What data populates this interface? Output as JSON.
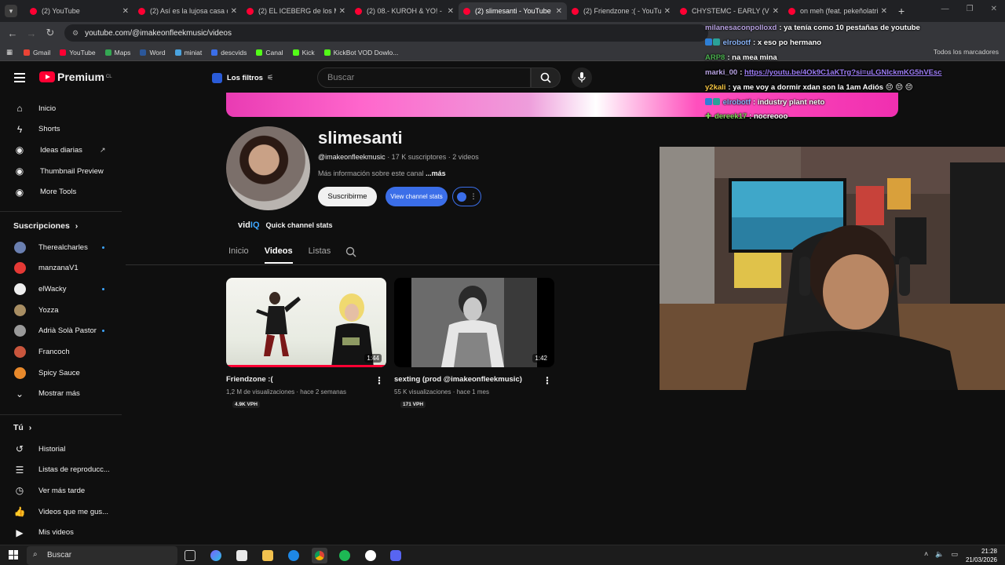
{
  "browser": {
    "tabs": [
      {
        "label": "(2) YouTube",
        "active": false
      },
      {
        "label": "(2) Así es la lujosa casa de",
        "active": false
      },
      {
        "label": "(2) EL ICEBERG de los MÚ",
        "active": false
      },
      {
        "label": "(2) 08.- KUROH & YO! - P",
        "active": false
      },
      {
        "label": "(2) slimesanti - YouTube",
        "active": true
      },
      {
        "label": "(2) Friendzone :( - YouTu",
        "active": false
      },
      {
        "label": "CHYSTEMC - EARLY (Vide",
        "active": false
      },
      {
        "label": "on meh (feat. pekeñolatri",
        "active": false
      }
    ],
    "url": "youtube.com/@imakeonfleekmusic/videos",
    "bookmarks": [
      "Gmail",
      "YouTube",
      "Maps",
      "Word",
      "miniat",
      "descvids",
      "Canal",
      "Kick",
      "KickBot VOD Dowlo..."
    ],
    "bookmark_colors": [
      "#ea4335",
      "#ff0033",
      "#34a853",
      "#2b579a",
      "#4aa3df",
      "#3b6ee8",
      "#53fc18",
      "#53fc18",
      "#53fc18"
    ],
    "all_bookmarks": "Todos los marcadores"
  },
  "header": {
    "logo": "Premium",
    "logo_country": "CL",
    "filters_label": "Los filtros",
    "search_placeholder": "Buscar"
  },
  "sidebar": {
    "main": [
      {
        "label": "Inicio",
        "icon": "home-icon"
      },
      {
        "label": "Shorts",
        "icon": "shorts-icon"
      },
      {
        "label": "Ideas diarias",
        "icon": "ideas-icon",
        "external": true
      },
      {
        "label": "Thumbnail Preview",
        "icon": "thumbnail-icon"
      },
      {
        "label": "More Tools",
        "icon": "tools-icon"
      }
    ],
    "subs_title": "Suscripciones",
    "subscriptions": [
      {
        "label": "Therealcharles",
        "color": "#6a7fb0",
        "dot": true
      },
      {
        "label": "manzanaV1",
        "color": "#e53935",
        "dot": false
      },
      {
        "label": "elWacky",
        "color": "#eeeeee",
        "dot": true
      },
      {
        "label": "Yozza",
        "color": "#a88e63",
        "dot": false
      },
      {
        "label": "Adrià Solà Pastor",
        "color": "#9a9a9a",
        "dot": true
      },
      {
        "label": "Francoch",
        "color": "#c9563d",
        "dot": false
      },
      {
        "label": "Spicy Sauce",
        "color": "#e8892b",
        "dot": false
      }
    ],
    "show_more": "Mostrar más",
    "you_title": "Tú",
    "you": [
      {
        "label": "Historial",
        "icon": "history-icon"
      },
      {
        "label": "Listas de reproducc...",
        "icon": "playlists-icon"
      },
      {
        "label": "Ver más tarde",
        "icon": "watch-later-icon"
      },
      {
        "label": "Videos que me gus...",
        "icon": "like-icon"
      },
      {
        "label": "Mis videos",
        "icon": "my-videos-icon"
      }
    ]
  },
  "channel": {
    "name": "slimesanti",
    "handle": "@imakeonfleekmusic",
    "stats": "· 17 K suscriptores · 2 videos",
    "more_info": "Más información sobre este canal",
    "more_link": "...más",
    "subscribe": "Suscribirme",
    "view_stats": "View channel stats",
    "vidiq_brand": "vid",
    "vidiq_brand_suffix": "IQ",
    "quick_stats": "Quick channel stats",
    "tabs": [
      "Inicio",
      "Videos",
      "Listas"
    ],
    "selected_tab": "Videos"
  },
  "videos": [
    {
      "title": "Friendzone :(",
      "meta": "1,2 M de visualizaciones · hace 2 semanas",
      "vph": "4.9K VPH",
      "duration": "1:44"
    },
    {
      "title": "sexting (prod @imakeonfleekmusic)",
      "meta": "55 K visualizaciones · hace 1 mes",
      "vph": "171 VPH",
      "duration": "1:42"
    }
  ],
  "chat": [
    {
      "user": "milanesaconpolloxd",
      "text": "ya tenía como 10 pestañas de youtube",
      "color": "#b9a3e3",
      "badge": false
    },
    {
      "user": "elrobotf",
      "text": "x eso po hermano",
      "color": "#8ab4f8",
      "badge": true
    },
    {
      "user": "ARP8",
      "text": "na mea mina",
      "color": "#4caf50",
      "badge": false
    },
    {
      "user": "marki_00",
      "text": "https://youtu.be/4Ok9C1aKTrg?si=uLGNIckmKG5hVEsc",
      "color": "#b9a3e3",
      "badge": false,
      "link": true
    },
    {
      "user": "y2kali",
      "text": "ya me voy a dormir xdan son la 1am Adiós 😔 😔 😔",
      "color": "#f5c542",
      "badge": false
    },
    {
      "user": "elrobotf",
      "text": "industry plant neto",
      "color": "#8ab4f8",
      "badge": true
    },
    {
      "user": "dereek17",
      "text": "nocreooo",
      "color": "#7ed957",
      "badge": false
    }
  ],
  "taskbar": {
    "search": "Buscar",
    "time": "21:28",
    "date": "21/03/2026"
  }
}
